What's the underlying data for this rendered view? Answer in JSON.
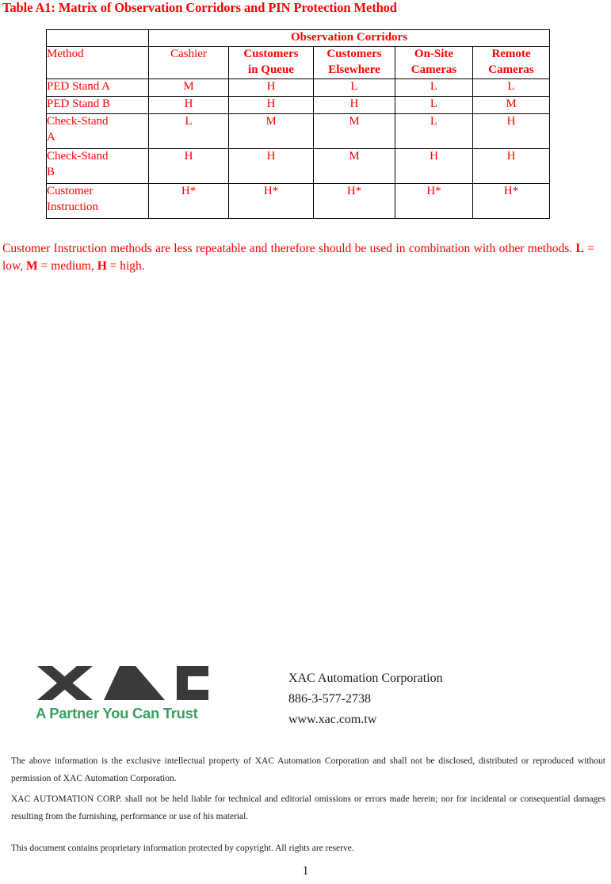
{
  "document": {
    "title": "Table A1: Matrix of Observation Corridors and PIN Protection Method",
    "page_number": "1"
  },
  "table": {
    "group_header": "Observation Corridors",
    "columns": [
      {
        "label": "Method",
        "bold": false
      },
      {
        "label": "Cashier",
        "bold": false
      },
      {
        "label": "Customers in Queue",
        "bold": true
      },
      {
        "label": "Customers Elsewhere",
        "bold": true
      },
      {
        "label": "On-Site Cameras",
        "bold": true
      },
      {
        "label": "Remote Cameras",
        "bold": true
      }
    ],
    "col_header_lines": {
      "queue_line1": "Customers",
      "queue_line2": "in Queue",
      "elsewhere_line1": "Customers",
      "elsewhere_line2": "Elsewhere",
      "onsite_line1": "On-Site",
      "onsite_line2": "Cameras",
      "remote_line1": "Remote",
      "remote_line2": "Cameras"
    },
    "rows": [
      {
        "method": "PED Stand A",
        "cashier": "M",
        "queue": "H",
        "elsewhere": "L",
        "onsite": "L",
        "remote": "L"
      },
      {
        "method": "PED Stand B",
        "cashier": "H",
        "queue": "H",
        "elsewhere": "H",
        "onsite": "L",
        "remote": "M"
      },
      {
        "method": "Check-Stand A",
        "cashier": "L",
        "queue": "M",
        "elsewhere": "M",
        "onsite": "L",
        "remote": "H"
      },
      {
        "method": "Check-Stand B",
        "cashier": "H",
        "queue": "H",
        "elsewhere": "M",
        "onsite": "H",
        "remote": "H"
      },
      {
        "method": "Customer Instruction",
        "cashier": "H*",
        "queue": "H*",
        "elsewhere": "H*",
        "onsite": "H*",
        "remote": "H*"
      }
    ],
    "row_label_lines": {
      "check_a_line1": "Check-Stand",
      "check_a_line2": "A",
      "check_b_line1": "Check-Stand",
      "check_b_line2": "B",
      "cust_instr_line1": "Customer",
      "cust_instr_line2": "Instruction"
    }
  },
  "note": {
    "text_part1": "Customer Instruction methods are less repeatable and therefore should be used in combination with other methods. ",
    "legend_l": "L",
    "legend_l_def": " = low, ",
    "legend_m": "M",
    "legend_m_def": " = medium, ",
    "legend_h": "H",
    "legend_h_def": " = high."
  },
  "logo": {
    "wordmark": "XAC",
    "tagline": "A Partner You Can Trust",
    "mark_color": "#3a3a3a",
    "tagline_color": "#3a9e62"
  },
  "company": {
    "name": "XAC Automation Corporation",
    "phone": "886-3-577-2738",
    "website": "www.xac.com.tw"
  },
  "legal": {
    "paragraph_1": "The above information is the exclusive intellectual property of XAC Automation Corporation and shall not be disclosed, distributed or reproduced without permission of XAC Automation Corporation.",
    "paragraph_2": "XAC AUTOMATION CORP. shall not be held liable for technical and editorial omissions or errors made herein; nor for incidental or consequential damages resulting from the furnishing, performance or use of his material.",
    "paragraph_3": "This document contains proprietary information protected by copyright. All rights are reserve."
  },
  "colors": {
    "accent_red": "#ff0000",
    "text_black": "#1a1a1a",
    "logo_green": "#3a9e62",
    "logo_dark": "#3a3a3a"
  }
}
